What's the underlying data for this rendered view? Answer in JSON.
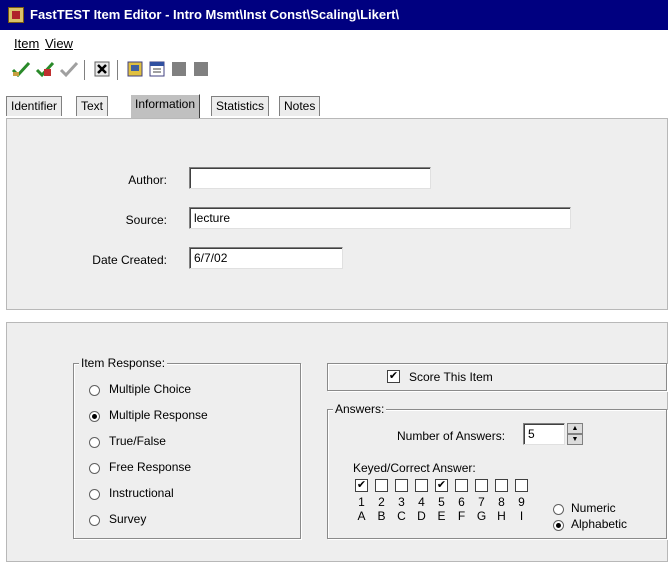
{
  "window": {
    "title": "FastTEST Item Editor - Intro Msmt\\Inst Const\\Scaling\\Likert\\"
  },
  "menu": {
    "item": "Item",
    "view": "View"
  },
  "toolbar": {
    "buttons": [
      "check-icon",
      "check-add-icon",
      "check-disabled-icon",
      "delete-icon",
      "document-icon",
      "list-icon",
      "gray-box-icon",
      "gray-box-icon"
    ]
  },
  "tabs": [
    "Identifier",
    "Text",
    "Information",
    "Statistics",
    "Notes"
  ],
  "info": {
    "author_label": "Author:",
    "author_value": "",
    "source_label": "Source:",
    "source_value": "lecture",
    "date_label": "Date Created:",
    "date_value": "6/7/02"
  },
  "item_response": {
    "title": "Item Response:",
    "options": [
      "Multiple Choice",
      "Multiple Response",
      "True/False",
      "Free Response",
      "Instructional",
      "Survey"
    ],
    "selected": "Multiple Response"
  },
  "score": {
    "label": "Score This Item",
    "checked": true
  },
  "answers": {
    "title": "Answers:",
    "num_label": "Number of Answers:",
    "num_value": "5",
    "keyed_label": "Keyed/Correct Answer:",
    "checked": [
      true,
      false,
      false,
      false,
      true,
      false,
      false,
      false,
      false
    ],
    "numbers": [
      "1",
      "2",
      "3",
      "4",
      "5",
      "6",
      "7",
      "8",
      "9"
    ],
    "letters": [
      "A",
      "B",
      "C",
      "D",
      "E",
      "F",
      "G",
      "H",
      "I"
    ],
    "format_numeric": "Numeric",
    "format_alphabetic": "Alphabetic",
    "format_selected": "Alphabetic"
  }
}
